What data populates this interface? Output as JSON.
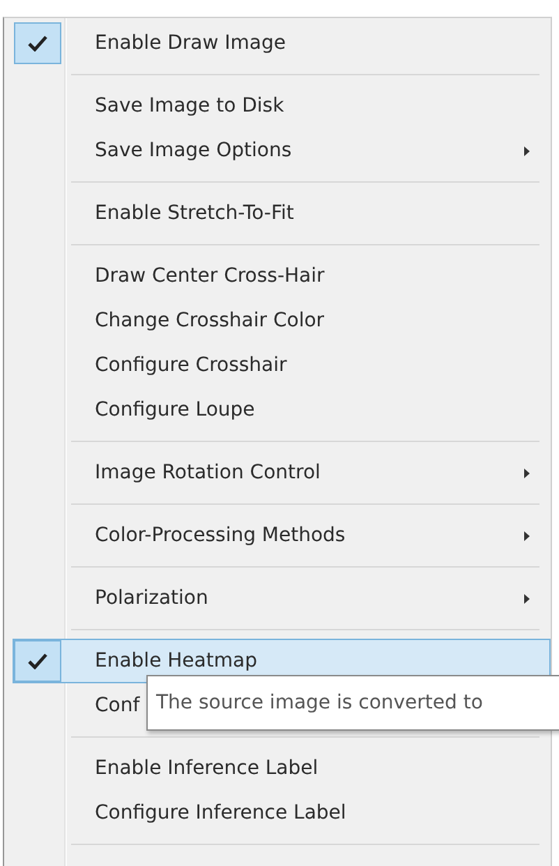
{
  "menu": {
    "groups": [
      {
        "items": [
          {
            "label": "Enable Draw Image",
            "checked": true,
            "submenu": false,
            "highlighted": false
          }
        ]
      },
      {
        "items": [
          {
            "label": "Save Image to Disk",
            "checked": false,
            "submenu": false,
            "highlighted": false
          },
          {
            "label": "Save Image Options",
            "checked": false,
            "submenu": true,
            "highlighted": false
          }
        ]
      },
      {
        "items": [
          {
            "label": "Enable Stretch-To-Fit",
            "checked": false,
            "submenu": false,
            "highlighted": false
          }
        ]
      },
      {
        "items": [
          {
            "label": "Draw Center Cross-Hair",
            "checked": false,
            "submenu": false,
            "highlighted": false
          },
          {
            "label": "Change Crosshair Color",
            "checked": false,
            "submenu": false,
            "highlighted": false
          },
          {
            "label": "Configure Crosshair",
            "checked": false,
            "submenu": false,
            "highlighted": false
          },
          {
            "label": "Configure Loupe",
            "checked": false,
            "submenu": false,
            "highlighted": false
          }
        ]
      },
      {
        "items": [
          {
            "label": "Image Rotation Control",
            "checked": false,
            "submenu": true,
            "highlighted": false
          }
        ]
      },
      {
        "items": [
          {
            "label": "Color-Processing Methods",
            "checked": false,
            "submenu": true,
            "highlighted": false
          }
        ]
      },
      {
        "items": [
          {
            "label": "Polarization",
            "checked": false,
            "submenu": true,
            "highlighted": false
          }
        ]
      },
      {
        "items": [
          {
            "label": "Enable Heatmap",
            "checked": true,
            "submenu": false,
            "highlighted": true
          },
          {
            "label": "Conf",
            "checked": false,
            "submenu": false,
            "highlighted": false,
            "tooltip": "The source image is converted to"
          }
        ]
      },
      {
        "items": [
          {
            "label": "Enable Inference Label",
            "checked": false,
            "submenu": false,
            "highlighted": false
          },
          {
            "label": "Configure Inference Label",
            "checked": false,
            "submenu": false,
            "highlighted": false
          }
        ]
      }
    ]
  }
}
